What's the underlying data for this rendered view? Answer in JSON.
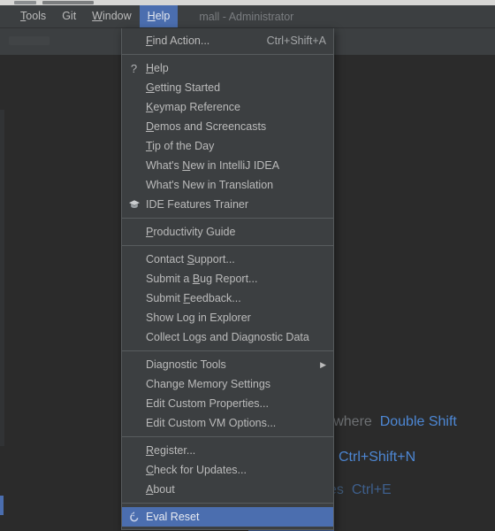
{
  "window": {
    "menubar": [
      {
        "label": "Tools",
        "mnemonic": "T",
        "active": false,
        "name": "menubar-item-tools"
      },
      {
        "label": "Git",
        "mnemonic": "",
        "active": false,
        "name": "menubar-item-git"
      },
      {
        "label": "Window",
        "mnemonic": "W",
        "active": false,
        "name": "menubar-item-window"
      },
      {
        "label": "Help",
        "mnemonic": "H",
        "active": true,
        "name": "menubar-item-help"
      }
    ],
    "project_title": "mall - Administrator"
  },
  "colors": {
    "menu_background": "#3c3f41",
    "editor_background": "#2b2b2b",
    "selection_blue": "#4b6eaf",
    "link_blue": "#4d87d4",
    "text": "#bbbbbb",
    "titlebar": "#d7d7d5"
  },
  "help_menu": {
    "items": [
      {
        "kind": "item",
        "label": "Find Action...",
        "mnemonic": "F",
        "accel": "Ctrl+Shift+A",
        "icon": "",
        "selected": false,
        "submenu": false,
        "name": "menu-item-find-action"
      },
      {
        "kind": "separator",
        "name": "menu-separator-1"
      },
      {
        "kind": "item",
        "label": "Help",
        "mnemonic": "H",
        "accel": "",
        "icon": "question-mark-icon",
        "selected": false,
        "submenu": false,
        "name": "menu-item-help"
      },
      {
        "kind": "item",
        "label": "Getting Started",
        "mnemonic": "G",
        "accel": "",
        "icon": "",
        "selected": false,
        "submenu": false,
        "name": "menu-item-getting-started"
      },
      {
        "kind": "item",
        "label": "Keymap Reference",
        "mnemonic": "K",
        "accel": "",
        "icon": "",
        "selected": false,
        "submenu": false,
        "name": "menu-item-keymap-reference"
      },
      {
        "kind": "item",
        "label": "Demos and Screencasts",
        "mnemonic": "D",
        "accel": "",
        "icon": "",
        "selected": false,
        "submenu": false,
        "name": "menu-item-demos-and-screencasts"
      },
      {
        "kind": "item",
        "label": "Tip of the Day",
        "mnemonic": "T",
        "accel": "",
        "icon": "",
        "selected": false,
        "submenu": false,
        "name": "menu-item-tip-of-the-day"
      },
      {
        "kind": "item",
        "label": "What's New in IntelliJ IDEA",
        "mnemonic": "N",
        "accel": "",
        "icon": "",
        "selected": false,
        "submenu": false,
        "name": "menu-item-whats-new-in-intellij-idea"
      },
      {
        "kind": "item",
        "label": "What's New in Translation",
        "mnemonic": "",
        "accel": "",
        "icon": "",
        "selected": false,
        "submenu": false,
        "name": "menu-item-whats-new-in-translation"
      },
      {
        "kind": "item",
        "label": "IDE Features Trainer",
        "mnemonic": "",
        "accel": "",
        "icon": "graduation-cap-icon",
        "selected": false,
        "submenu": false,
        "name": "menu-item-ide-features-trainer"
      },
      {
        "kind": "separator",
        "name": "menu-separator-2"
      },
      {
        "kind": "item",
        "label": "Productivity Guide",
        "mnemonic": "P",
        "accel": "",
        "icon": "",
        "selected": false,
        "submenu": false,
        "name": "menu-item-productivity-guide"
      },
      {
        "kind": "separator",
        "name": "menu-separator-3"
      },
      {
        "kind": "item",
        "label": "Contact Support...",
        "mnemonic": "S",
        "accel": "",
        "icon": "",
        "selected": false,
        "submenu": false,
        "name": "menu-item-contact-support"
      },
      {
        "kind": "item",
        "label": "Submit a Bug Report...",
        "mnemonic": "B",
        "accel": "",
        "icon": "",
        "selected": false,
        "submenu": false,
        "name": "menu-item-submit-a-bug-report"
      },
      {
        "kind": "item",
        "label": "Submit Feedback...",
        "mnemonic": "F",
        "accel": "",
        "icon": "",
        "selected": false,
        "submenu": false,
        "name": "menu-item-submit-feedback"
      },
      {
        "kind": "item",
        "label": "Show Log in Explorer",
        "mnemonic": "",
        "accel": "",
        "icon": "",
        "selected": false,
        "submenu": false,
        "name": "menu-item-show-log-in-explorer"
      },
      {
        "kind": "item",
        "label": "Collect Logs and Diagnostic Data",
        "mnemonic": "",
        "accel": "",
        "icon": "",
        "selected": false,
        "submenu": false,
        "name": "menu-item-collect-logs-and-diagnostic-data"
      },
      {
        "kind": "separator",
        "name": "menu-separator-4"
      },
      {
        "kind": "item",
        "label": "Diagnostic Tools",
        "mnemonic": "",
        "accel": "",
        "icon": "",
        "selected": false,
        "submenu": true,
        "name": "menu-item-diagnostic-tools"
      },
      {
        "kind": "item",
        "label": "Change Memory Settings",
        "mnemonic": "",
        "accel": "",
        "icon": "",
        "selected": false,
        "submenu": false,
        "name": "menu-item-change-memory-settings"
      },
      {
        "kind": "item",
        "label": "Edit Custom Properties...",
        "mnemonic": "",
        "accel": "",
        "icon": "",
        "selected": false,
        "submenu": false,
        "name": "menu-item-edit-custom-properties"
      },
      {
        "kind": "item",
        "label": "Edit Custom VM Options...",
        "mnemonic": "",
        "accel": "",
        "icon": "",
        "selected": false,
        "submenu": false,
        "name": "menu-item-edit-custom-vm-options"
      },
      {
        "kind": "separator",
        "name": "menu-separator-5"
      },
      {
        "kind": "item",
        "label": "Register...",
        "mnemonic": "R",
        "accel": "",
        "icon": "",
        "selected": false,
        "submenu": false,
        "name": "menu-item-register"
      },
      {
        "kind": "item",
        "label": "Check for Updates...",
        "mnemonic": "C",
        "accel": "",
        "icon": "",
        "selected": false,
        "submenu": false,
        "name": "menu-item-check-for-updates"
      },
      {
        "kind": "item",
        "label": "About",
        "mnemonic": "A",
        "accel": "",
        "icon": "",
        "selected": false,
        "submenu": false,
        "name": "menu-item-about"
      },
      {
        "kind": "separator",
        "name": "menu-separator-6"
      },
      {
        "kind": "item",
        "label": "Eval Reset",
        "mnemonic": "",
        "accel": "",
        "icon": "reset-arrow-icon",
        "selected": true,
        "submenu": false,
        "name": "menu-item-eval-reset"
      }
    ]
  },
  "editor_hints": [
    {
      "text": "erywhere",
      "key": "Double Shift",
      "name": "hint-search-everywhere"
    },
    {
      "text": "",
      "key": "Ctrl+Shift+N",
      "name": "hint-go-to-file"
    },
    {
      "text": "Recent Files",
      "key": "Ctrl+E",
      "name": "hint-recent-files"
    }
  ]
}
